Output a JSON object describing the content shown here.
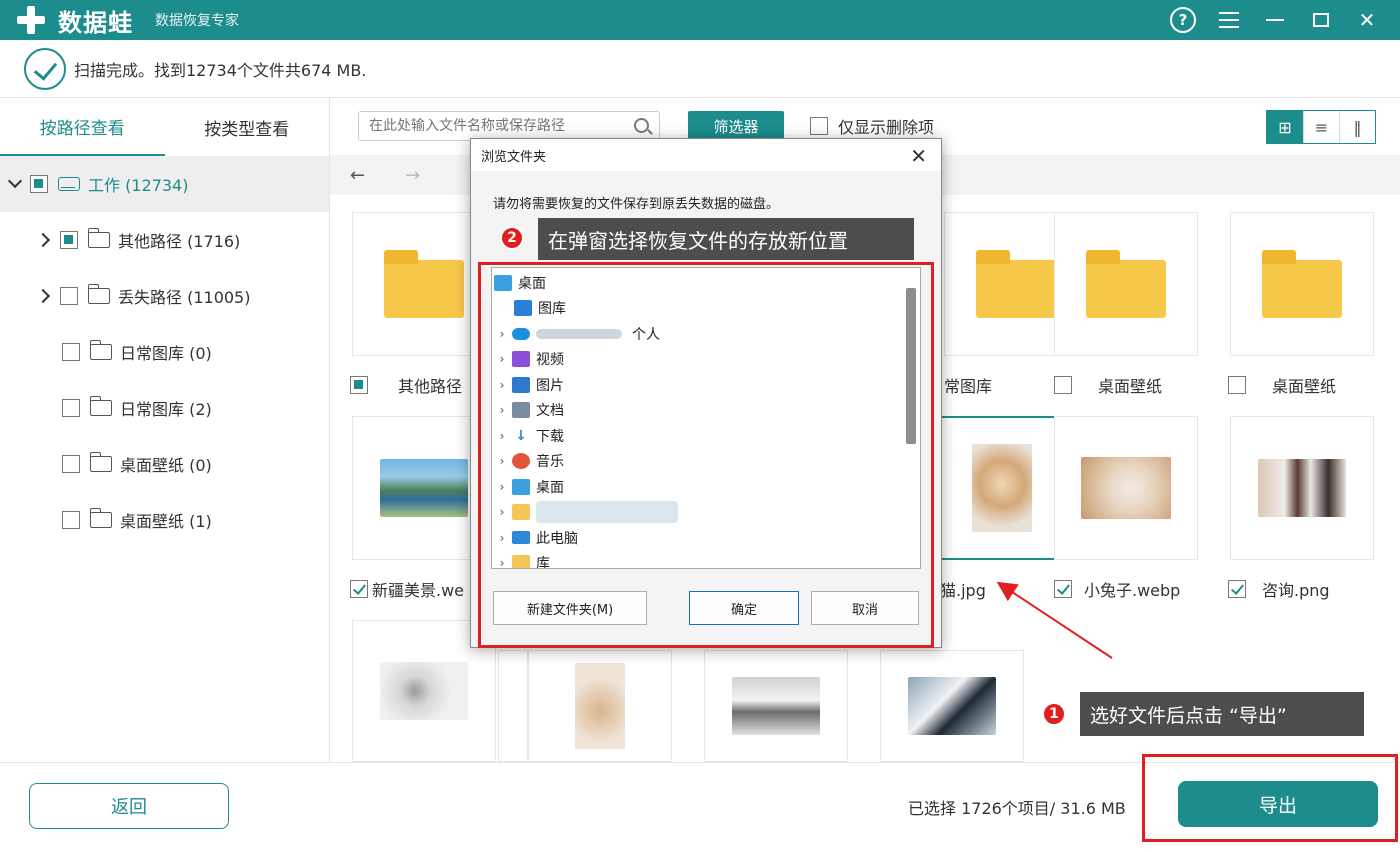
{
  "app": {
    "name": "数据蛙",
    "subtitle": "数据恢复专家",
    "help_icon": "?"
  },
  "status": {
    "text": "扫描完成。找到12734个文件共674 MB."
  },
  "sidebar": {
    "tabs": [
      {
        "label": "按路径查看",
        "active": true
      },
      {
        "label": "按类型查看",
        "active": false
      }
    ],
    "root": {
      "label": "工作 (12734)"
    },
    "items": [
      {
        "label": "其他路径 (1716)",
        "expandable": true,
        "check": "partial"
      },
      {
        "label": "丢失路径 (11005)",
        "expandable": true,
        "check": "none"
      },
      {
        "label": "日常图库 (0)",
        "expandable": false,
        "check": "none"
      },
      {
        "label": "日常图库 (2)",
        "expandable": false,
        "check": "none"
      },
      {
        "label": "桌面壁纸 (0)",
        "expandable": false,
        "check": "none"
      },
      {
        "label": "桌面壁纸 (1)",
        "expandable": false,
        "check": "none"
      }
    ]
  },
  "toolbar": {
    "search_placeholder": "在此处输入文件名称或保存路径",
    "filter_label": "筛选器",
    "only_deleted_label": "仅显示删除项"
  },
  "nav": {
    "back": "←",
    "forward": "→"
  },
  "grid": {
    "row1_labels": [
      "其他路径",
      "常图库",
      "桌面壁纸",
      "桌面壁纸"
    ],
    "row2_labels": [
      "新疆美景.we",
      "猫.jpg",
      "小兔子.webp",
      "咨询.png"
    ]
  },
  "dialog": {
    "title": "浏览文件夹",
    "close": "✕",
    "message": "请勿将需要恢复的文件保存到原丢失数据的磁盘。",
    "tree": [
      {
        "label": "桌面",
        "indent": 0,
        "expander": "",
        "icon": "desktop-icon",
        "color": "#3aa0e0"
      },
      {
        "label": "图库",
        "indent": 1,
        "expander": "",
        "icon": "gallery-icon",
        "color": "#2b7fd8"
      },
      {
        "label": "个人",
        "indent": 1,
        "expander": "›",
        "icon": "onedrive-icon",
        "color": "#1e8fe0"
      },
      {
        "label": "视频",
        "indent": 1,
        "expander": "›",
        "icon": "video-icon",
        "color": "#8a4fd8"
      },
      {
        "label": "图片",
        "indent": 1,
        "expander": "›",
        "icon": "pictures-icon",
        "color": "#2f78d0"
      },
      {
        "label": "文档",
        "indent": 1,
        "expander": "›",
        "icon": "documents-icon",
        "color": "#7a8aa0"
      },
      {
        "label": "下载",
        "indent": 1,
        "expander": "›",
        "icon": "download-icon",
        "color": "#2a8ad8"
      },
      {
        "label": "音乐",
        "indent": 1,
        "expander": "›",
        "icon": "music-icon",
        "color": "#e2543a"
      },
      {
        "label": "桌面",
        "indent": 1,
        "expander": "›",
        "icon": "desktop-icon",
        "color": "#3aa0e0"
      },
      {
        "label": "",
        "indent": 1,
        "expander": "›",
        "icon": "folder-icon",
        "color": "#f2c75a"
      },
      {
        "label": "此电脑",
        "indent": 1,
        "expander": "›",
        "icon": "computer-icon",
        "color": "#2a8ad8"
      },
      {
        "label": "库",
        "indent": 1,
        "expander": "›",
        "icon": "folder-icon",
        "color": "#f2c75a"
      }
    ],
    "new_folder_label": "新建文件夹(M)",
    "ok_label": "确定",
    "cancel_label": "取消"
  },
  "annotations": {
    "step1_num": "1",
    "step1_text": "选好文件后点击 “导出”",
    "step2_num": "2",
    "step2_text": "在弹窗选择恢复文件的存放新位置"
  },
  "bottom": {
    "back_label": "返回",
    "selected_info": "已选择 1726个项目/ 31.6 MB",
    "export_label": "导出"
  },
  "colors": {
    "brand": "#1d8c8c",
    "highlight": "#e02020",
    "annotation_bg": "#4d4d4d"
  }
}
